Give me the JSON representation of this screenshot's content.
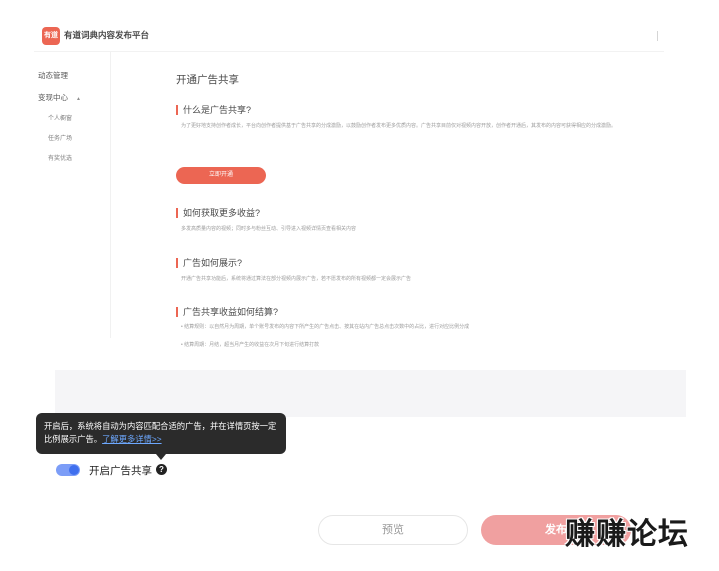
{
  "screenshot": {
    "logo_text": "有道",
    "brand": "有道词典内容发布平台",
    "sidebar": {
      "items": [
        {
          "label": "动态管理"
        },
        {
          "label": "变现中心"
        }
      ],
      "sub_items": [
        {
          "label": "个人橱窗"
        },
        {
          "label": "任务广场"
        },
        {
          "label": "有奖优选"
        }
      ]
    },
    "page_title": "开通广告共享",
    "sections": [
      {
        "title": "什么是广告共享?",
        "text": "为了更好地支持创作者成长，平台向创作者提供基于广告共享的分成激励，以鼓励创作者发布更多优质内容。广告共享目前仅对视频内容开放，创作者开通后，其发布的内容可获得相应的分成激励。"
      },
      {
        "title": "如何获取更多收益?",
        "text": "多发高质量内容的视频；同时多与粉丝互动、引导进入视频详情页查看相关内容"
      },
      {
        "title": "广告如何展示?",
        "text": "开通广告共享功能后，系统将通过算法在部分视频内展示广告，若不愿发布的所有视频都一定会展示广告"
      },
      {
        "title": "广告共享收益如何结算?",
        "text": "• 结算规则：以自然月为周期，单个账号发布的内容下所产生的广告点击、按其在站内广告总点击次数中的占比，进行对应比例分成",
        "text2": "• 结算周期：月结，超当月产生的收益在次月下旬进行结算打款"
      }
    ],
    "open_button": "立即开通"
  },
  "tooltip": {
    "text": "开启后，系统将自动为内容匹配合适的广告，并在详情页按一定比例展示广告。",
    "link": "了解更多详情>>"
  },
  "toggle": {
    "label": "开启广告共享",
    "enabled": true,
    "help_icon": "?"
  },
  "footer": {
    "preview": "预览",
    "publish": "发布"
  },
  "watermark": "赚赚论坛",
  "colors": {
    "accent": "#e8452e",
    "toggle_on": "#3f6fee",
    "publish_bg": "#f0a0a0",
    "tooltip_bg": "#2b2b2b"
  }
}
